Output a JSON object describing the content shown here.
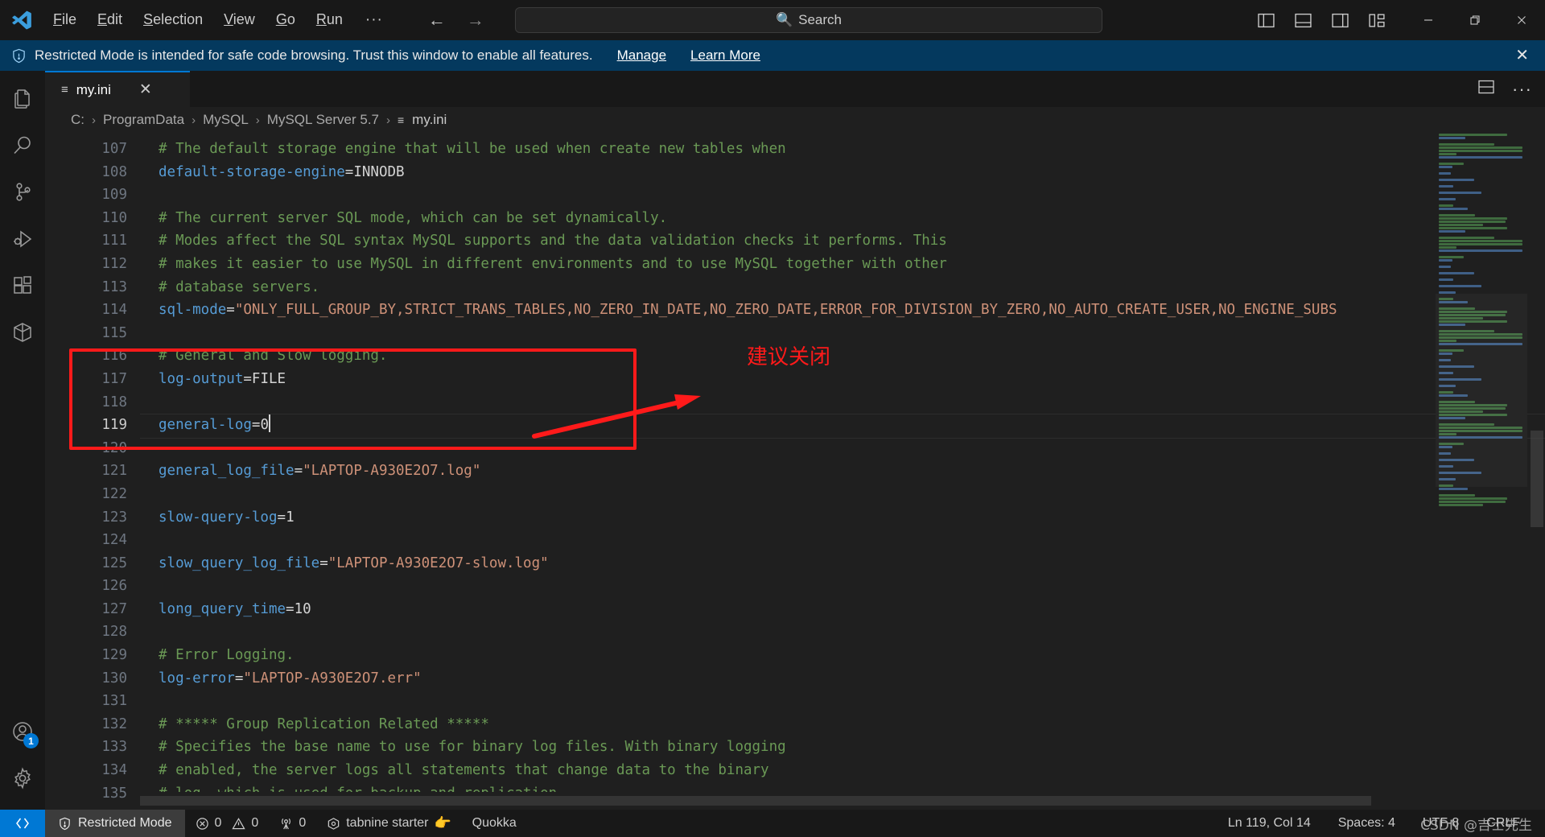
{
  "titlebar": {
    "logo_icon": "vscode-logo-icon",
    "menus": [
      {
        "label": "File",
        "accel": "F"
      },
      {
        "label": "Edit",
        "accel": "E"
      },
      {
        "label": "Selection",
        "accel": "S"
      },
      {
        "label": "View",
        "accel": "V"
      },
      {
        "label": "Go",
        "accel": "G"
      },
      {
        "label": "Run",
        "accel": "R"
      },
      {
        "label": "···",
        "accel": ""
      }
    ],
    "nav_back": "←",
    "nav_forward": "→",
    "search_placeholder": "Search",
    "search_value": "",
    "search_icon": "magnifier-icon",
    "layout_icons": [
      "toggle-primary-sidebar-icon",
      "toggle-panel-icon",
      "toggle-secondary-sidebar-icon",
      "customize-layout-icon"
    ],
    "window_controls": [
      "minimize-icon",
      "restore-icon",
      "close-icon"
    ]
  },
  "banner": {
    "shield_icon": "shield-icon",
    "message": "Restricted Mode is intended for safe code browsing. Trust this window to enable all features.",
    "manage_label": "Manage",
    "learn_more_label": "Learn More",
    "close_icon": "close-icon",
    "background": "#04395e"
  },
  "activitybar": {
    "top_items": [
      {
        "name": "explorer",
        "icon": "files-icon"
      },
      {
        "name": "search",
        "icon": "search-icon"
      },
      {
        "name": "source-control",
        "icon": "source-control-icon"
      },
      {
        "name": "run-and-debug",
        "icon": "run-debug-icon"
      },
      {
        "name": "extensions",
        "icon": "extensions-icon"
      },
      {
        "name": "remote-explorer",
        "icon": "remote-box-icon"
      }
    ],
    "bottom_items": [
      {
        "name": "accounts",
        "icon": "account-icon",
        "badge": "1"
      },
      {
        "name": "manage-settings",
        "icon": "gear-icon",
        "badge": ""
      }
    ]
  },
  "editor": {
    "tab": {
      "label": "my.ini",
      "file_icon": "ini-file-icon",
      "close_icon": "close-icon",
      "active": true
    },
    "tab_actions": [
      "split-editor-icon",
      "more-actions-icon"
    ],
    "breadcrumb": [
      "C:",
      "ProgramData",
      "MySQL",
      "MySQL Server 5.7",
      "my.ini"
    ],
    "breadcrumb_separator": "›",
    "first_line_number": 107,
    "active_line": 119,
    "lines": [
      {
        "n": 107,
        "tokens": [
          {
            "t": "comment",
            "v": "# The default storage engine that will be used when create new tables when"
          }
        ]
      },
      {
        "n": 108,
        "tokens": [
          {
            "t": "key",
            "v": "default-storage-engine"
          },
          {
            "t": "eq",
            "v": "="
          },
          {
            "t": "num",
            "v": "INNODB"
          }
        ]
      },
      {
        "n": 109,
        "tokens": []
      },
      {
        "n": 110,
        "tokens": [
          {
            "t": "comment",
            "v": "# The current server SQL mode, which can be set dynamically."
          }
        ]
      },
      {
        "n": 111,
        "tokens": [
          {
            "t": "comment",
            "v": "# Modes affect the SQL syntax MySQL supports and the data validation checks it performs. This"
          }
        ]
      },
      {
        "n": 112,
        "tokens": [
          {
            "t": "comment",
            "v": "# makes it easier to use MySQL in different environments and to use MySQL together with other"
          }
        ]
      },
      {
        "n": 113,
        "tokens": [
          {
            "t": "comment",
            "v": "# database servers."
          }
        ]
      },
      {
        "n": 114,
        "tokens": [
          {
            "t": "key",
            "v": "sql-mode"
          },
          {
            "t": "eq",
            "v": "="
          },
          {
            "t": "str",
            "v": "\"ONLY_FULL_GROUP_BY,STRICT_TRANS_TABLES,NO_ZERO_IN_DATE,NO_ZERO_DATE,ERROR_FOR_DIVISION_BY_ZERO,NO_AUTO_CREATE_USER,NO_ENGINE_SUBS"
          }
        ]
      },
      {
        "n": 115,
        "tokens": []
      },
      {
        "n": 116,
        "tokens": [
          {
            "t": "comment",
            "v": "# General and Slow logging."
          }
        ]
      },
      {
        "n": 117,
        "tokens": [
          {
            "t": "key",
            "v": "log-output"
          },
          {
            "t": "eq",
            "v": "="
          },
          {
            "t": "num",
            "v": "FILE"
          }
        ]
      },
      {
        "n": 118,
        "tokens": []
      },
      {
        "n": 119,
        "tokens": [
          {
            "t": "key",
            "v": "general-log"
          },
          {
            "t": "eq",
            "v": "="
          },
          {
            "t": "num",
            "v": "0"
          },
          {
            "t": "cursor",
            "v": ""
          }
        ]
      },
      {
        "n": 120,
        "tokens": []
      },
      {
        "n": 121,
        "tokens": [
          {
            "t": "key",
            "v": "general_log_file"
          },
          {
            "t": "eq",
            "v": "="
          },
          {
            "t": "str",
            "v": "\"LAPTOP-A930E2O7.log\""
          }
        ]
      },
      {
        "n": 122,
        "tokens": []
      },
      {
        "n": 123,
        "tokens": [
          {
            "t": "key",
            "v": "slow-query-log"
          },
          {
            "t": "eq",
            "v": "="
          },
          {
            "t": "num",
            "v": "1"
          }
        ]
      },
      {
        "n": 124,
        "tokens": []
      },
      {
        "n": 125,
        "tokens": [
          {
            "t": "key",
            "v": "slow_query_log_file"
          },
          {
            "t": "eq",
            "v": "="
          },
          {
            "t": "str",
            "v": "\"LAPTOP-A930E2O7-slow.log\""
          }
        ]
      },
      {
        "n": 126,
        "tokens": []
      },
      {
        "n": 127,
        "tokens": [
          {
            "t": "key",
            "v": "long_query_time"
          },
          {
            "t": "eq",
            "v": "="
          },
          {
            "t": "num",
            "v": "10"
          }
        ]
      },
      {
        "n": 128,
        "tokens": []
      },
      {
        "n": 129,
        "tokens": [
          {
            "t": "comment",
            "v": "# Error Logging."
          }
        ]
      },
      {
        "n": 130,
        "tokens": [
          {
            "t": "key",
            "v": "log-error"
          },
          {
            "t": "eq",
            "v": "="
          },
          {
            "t": "str",
            "v": "\"LAPTOP-A930E2O7.err\""
          }
        ]
      },
      {
        "n": 131,
        "tokens": []
      },
      {
        "n": 132,
        "tokens": [
          {
            "t": "comment",
            "v": "# ***** Group Replication Related *****"
          }
        ]
      },
      {
        "n": 133,
        "tokens": [
          {
            "t": "comment",
            "v": "# Specifies the base name to use for binary log files. With binary logging"
          }
        ]
      },
      {
        "n": 134,
        "tokens": [
          {
            "t": "comment",
            "v": "# enabled, the server logs all statements that change data to the binary"
          }
        ]
      },
      {
        "n": 135,
        "tokens": [
          {
            "t": "comment",
            "v": "# log, which is used for backup and replication."
          }
        ]
      }
    ]
  },
  "annotations": {
    "highlight_box": {
      "name": "general-log-highlight-box",
      "color": "#ff1a1a"
    },
    "arrow": {
      "name": "red-arrow",
      "color": "#ff1a1a"
    },
    "note_text": "建议关闭",
    "note_color": "#ff1a1a"
  },
  "statusbar": {
    "remote_icon": "remote-window-icon",
    "trust_label": "Restricted Mode",
    "trust_icon": "shield-icon",
    "problems": {
      "errors_icon": "error-icon",
      "errors": "0",
      "warnings_icon": "warning-icon",
      "warnings": "0"
    },
    "ports": {
      "icon": "radio-tower-icon",
      "count": "0"
    },
    "tabnine": {
      "icon": "tabnine-icon",
      "label": "tabnine starter",
      "hand_icon": "pointing-hand-icon"
    },
    "quokka_label": "Quokka",
    "cursor_position": "Ln 119, Col 14",
    "indentation": "Spaces: 4",
    "encoding": "UTF-8",
    "eol": "CRLF",
    "watermark": "CSDN @吉士先生"
  }
}
